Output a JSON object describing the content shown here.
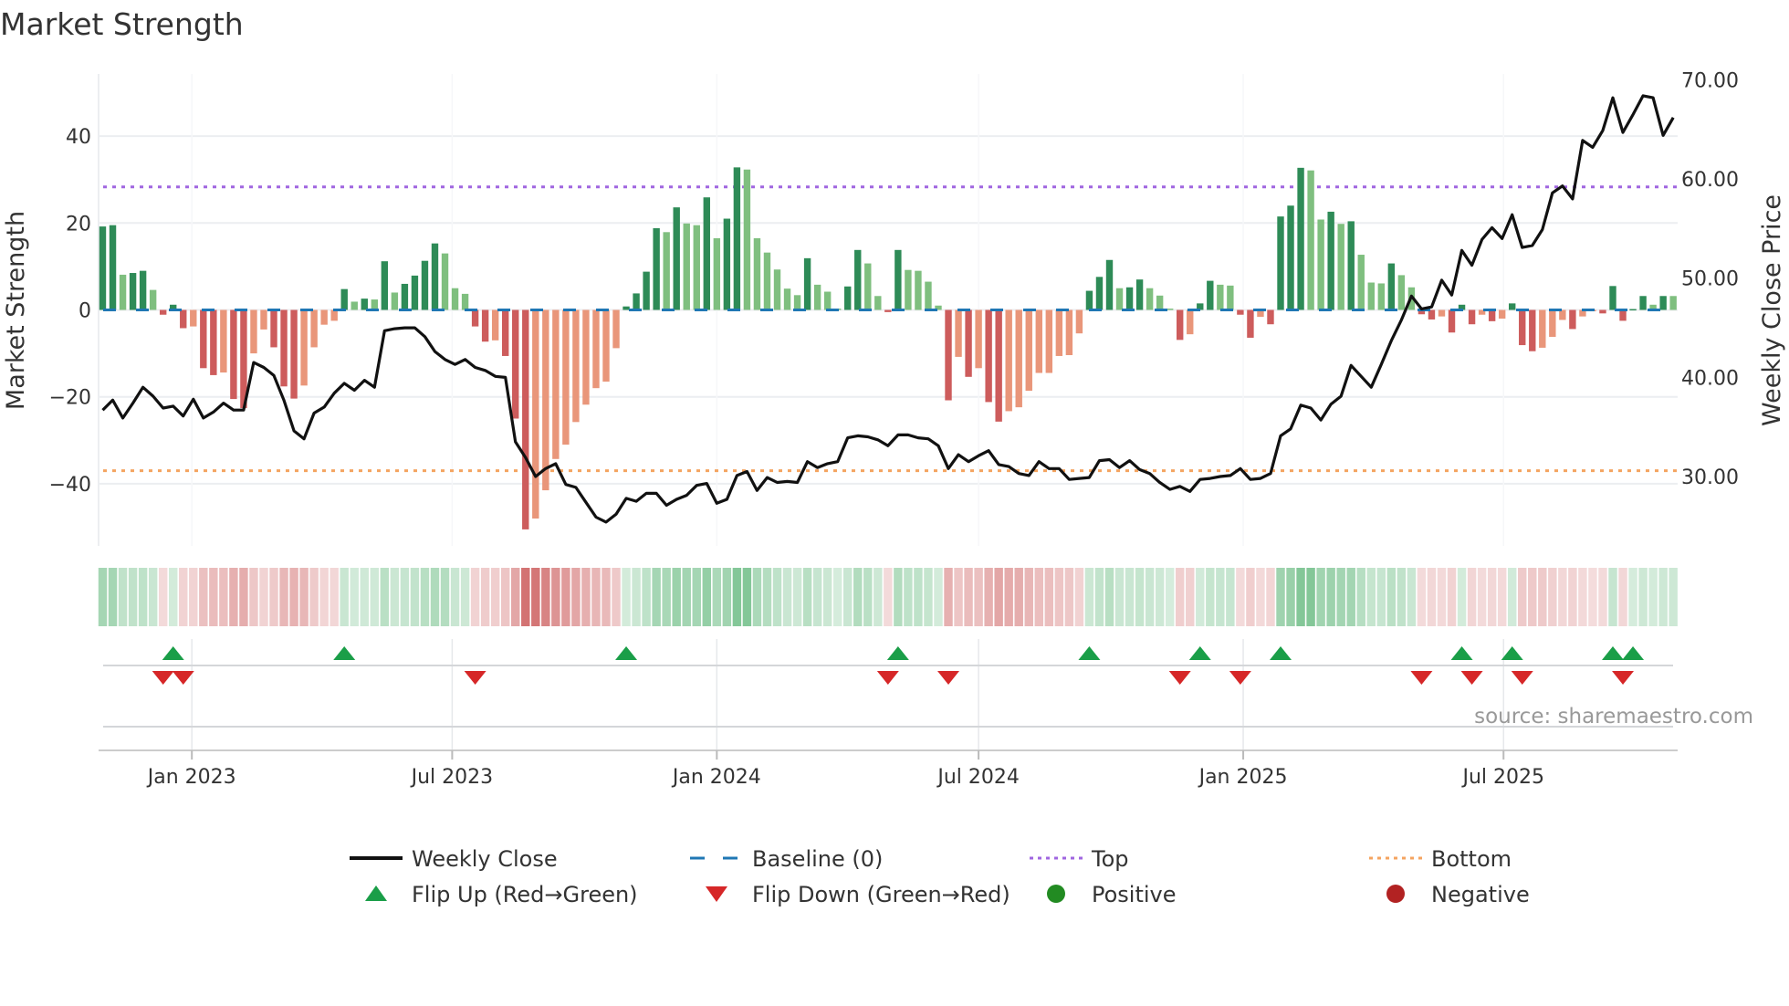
{
  "chart_data": {
    "type": "bar",
    "title": "Market Strength",
    "start_date": "2022-10-31",
    "frequency": "weekly",
    "left_axis": {
      "label": "Market Strength",
      "ylim": [
        -54.3,
        54.3
      ],
      "ticks": [
        40,
        20,
        0,
        -20,
        -40
      ],
      "tick_labels": [
        "40",
        "20",
        "0",
        "−20",
        "−40"
      ]
    },
    "right_axis": {
      "label": "Weekly Close Price",
      "ylim": [
        23.0,
        70.6
      ],
      "ticks": [
        70,
        60,
        50,
        40,
        30
      ],
      "tick_labels": [
        "70.00",
        "60.00",
        "50.00",
        "40.00",
        "30.00"
      ]
    },
    "x_ticks": [
      {
        "date": "2023-01-01",
        "label": "Jan 2023"
      },
      {
        "date": "2023-07-01",
        "label": "Jul 2023"
      },
      {
        "date": "2024-01-01",
        "label": "Jan 2024"
      },
      {
        "date": "2024-07-01",
        "label": "Jul 2024"
      },
      {
        "date": "2025-01-01",
        "label": "Jan 2025"
      },
      {
        "date": "2025-07-01",
        "label": "Jul 2025"
      }
    ],
    "top_level": 28.3,
    "bottom_level": -37.0,
    "baseline": 0,
    "strength": [
      19.2,
      19.5,
      8.1,
      8.5,
      9,
      4.6,
      -1.1,
      1.2,
      -4.2,
      -3.8,
      -13.4,
      -15,
      -14.4,
      -20.5,
      -22.6,
      -10,
      -4.5,
      -8.6,
      -17.6,
      -20.4,
      -17.4,
      -8.6,
      -3.4,
      -2.5,
      4.8,
      1.9,
      2.6,
      2.4,
      11.2,
      4,
      6,
      7.9,
      11.3,
      15.3,
      13,
      5,
      3.7,
      -3.8,
      -7.3,
      -7,
      -10.6,
      -25,
      -50.5,
      -48,
      -41.5,
      -34.3,
      -31,
      -25.8,
      -21.8,
      -18,
      -16.5,
      -8.8,
      0.8,
      3.8,
      8.8,
      18.8,
      17.9,
      23.6,
      19.9,
      19.5,
      25.9,
      16.5,
      21,
      32.8,
      32.3,
      16.5,
      13.2,
      9.3,
      4.9,
      3.4,
      11.9,
      5.8,
      4.2,
      0.3,
      5.4,
      13.8,
      10.7,
      3.2,
      -0.5,
      13.8,
      9.2,
      9,
      6.5,
      1,
      -20.8,
      -10.8,
      -15.4,
      -13.4,
      -21.2,
      -25.7,
      -23.3,
      -22.4,
      -18.6,
      -14.5,
      -14.5,
      -10.6,
      -10.4,
      -5.4,
      4.4,
      7.6,
      11.5,
      5,
      5.2,
      7,
      5,
      3.3,
      0.3,
      -6.9,
      -5.6,
      1.5,
      6.7,
      5.8,
      5.6,
      -1.1,
      -6.4,
      -1.6,
      -3.3,
      21.5,
      24,
      32.7,
      32.1,
      20.8,
      22.6,
      19.8,
      20.4,
      12.7,
      6.3,
      6.1,
      10.7,
      8,
      5.2,
      -1,
      -2.2,
      -1.5,
      -5.2,
      1.2,
      -3.3,
      -1.1,
      -2.6,
      -2,
      1.5,
      -8.1,
      -9.5,
      -8.7,
      -6.2,
      -2.3,
      -4.4,
      -1.5,
      -0.3,
      -0.8,
      5.5,
      -2.5,
      0.2,
      3.2,
      1.2,
      3.2,
      3.2
    ],
    "weekly_close": [
      36.7,
      37.7,
      35.9,
      37.4,
      39.0,
      38.1,
      36.9,
      37.1,
      36.1,
      37.8,
      35.9,
      36.5,
      37.4,
      36.7,
      36.7,
      41.5,
      41.0,
      40.2,
      37.7,
      34.6,
      33.8,
      36.4,
      37.0,
      38.4,
      39.4,
      38.7,
      39.7,
      39.0,
      44.7,
      44.9,
      45.0,
      45.0,
      44.1,
      42.6,
      41.8,
      41.3,
      41.8,
      41.0,
      40.7,
      40.1,
      40.0,
      33.5,
      31.9,
      30.0,
      30.8,
      31.3,
      29.2,
      28.9,
      27.4,
      25.9,
      25.4,
      26.2,
      27.8,
      27.5,
      28.3,
      28.3,
      27.1,
      27.7,
      28.1,
      29.1,
      29.3,
      27.3,
      27.7,
      30.1,
      30.5,
      28.6,
      29.9,
      29.4,
      29.5,
      29.4,
      31.5,
      30.9,
      31.3,
      31.5,
      33.9,
      34.1,
      34.0,
      33.7,
      33.1,
      34.2,
      34.2,
      33.9,
      33.8,
      33.1,
      30.8,
      32.2,
      31.5,
      32.1,
      32.6,
      31.2,
      31.0,
      30.3,
      30.1,
      31.5,
      30.8,
      30.8,
      29.7,
      29.8,
      29.9,
      31.6,
      31.7,
      30.9,
      31.6,
      30.7,
      30.3,
      29.4,
      28.7,
      29.0,
      28.5,
      29.7,
      29.8,
      30.0,
      30.1,
      30.8,
      29.7,
      29.8,
      30.3,
      34.1,
      34.8,
      37.2,
      36.9,
      35.7,
      37.3,
      38.1,
      41.2,
      40.1,
      39.0,
      41.3,
      43.7,
      45.8,
      48.2,
      46.9,
      47.1,
      49.8,
      48.3,
      52.8,
      51.3,
      53.9,
      55.1,
      54.0,
      56.4,
      53.1,
      53.3,
      54.9,
      58.6,
      59.3,
      58.0,
      63.9,
      63.2,
      64.9,
      68.2,
      64.7,
      66.5,
      68.4,
      68.2,
      64.4,
      66.2
    ],
    "legend": {
      "position": "bottom",
      "items": [
        {
          "key": "close",
          "label": "Weekly Close"
        },
        {
          "key": "baseline",
          "label": "Baseline (0)"
        },
        {
          "key": "top",
          "label": "Top"
        },
        {
          "key": "bottom",
          "label": "Bottom"
        },
        {
          "key": "flip_up",
          "label": "Flip Up (Red→Green)"
        },
        {
          "key": "flip_down",
          "label": "Flip Down (Green→Red)"
        },
        {
          "key": "positive",
          "label": "Positive"
        },
        {
          "key": "negative",
          "label": "Negative"
        }
      ]
    },
    "colors": {
      "pos_strong": "#2e8b57",
      "pos_weak": "#7fbf7f",
      "neg_strong": "#cd5c5c",
      "neg_weak": "#e9967a",
      "close": "#111111",
      "baseline": "#1f77b4",
      "top": "#a066e0",
      "bottom": "#f4a460",
      "flip_up": "#1a9e48",
      "flip_down": "#d62728",
      "positive": "#228b22",
      "negative": "#b22222",
      "strip_pos": "46,160,80",
      "strip_neg": "200,80,80"
    }
  },
  "source": "source: sharemaestro.com"
}
